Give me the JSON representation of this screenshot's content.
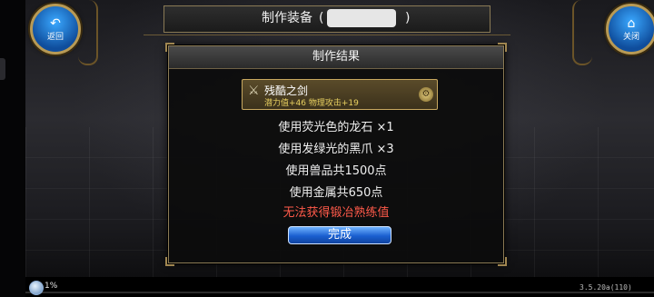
{
  "header": {
    "title": "制作装备",
    "paren_open": "(",
    "paren_close": ")"
  },
  "nav": {
    "back_label": "返回",
    "close_label": "关闭"
  },
  "dialog": {
    "title": "制作结果",
    "item": {
      "name": "残酷之剑",
      "stats": "潜力值+46  物理攻击+19"
    },
    "lines": [
      "使用荧光色的龙石  ×1",
      "使用发绿光的黑爪  ×3",
      "使用兽品共1500点",
      "使用金属共650点"
    ],
    "warning": "无法获得锻冶熟练值",
    "done_label": "完成"
  },
  "status": {
    "fatigue_percent": "1%",
    "version": "3.5.20a(110)"
  },
  "colors": {
    "accent_blue": "#1a5fd0",
    "gold_border": "#c8a860",
    "warning_red": "#ff5a4a",
    "stat_yellow": "#e8d060"
  }
}
